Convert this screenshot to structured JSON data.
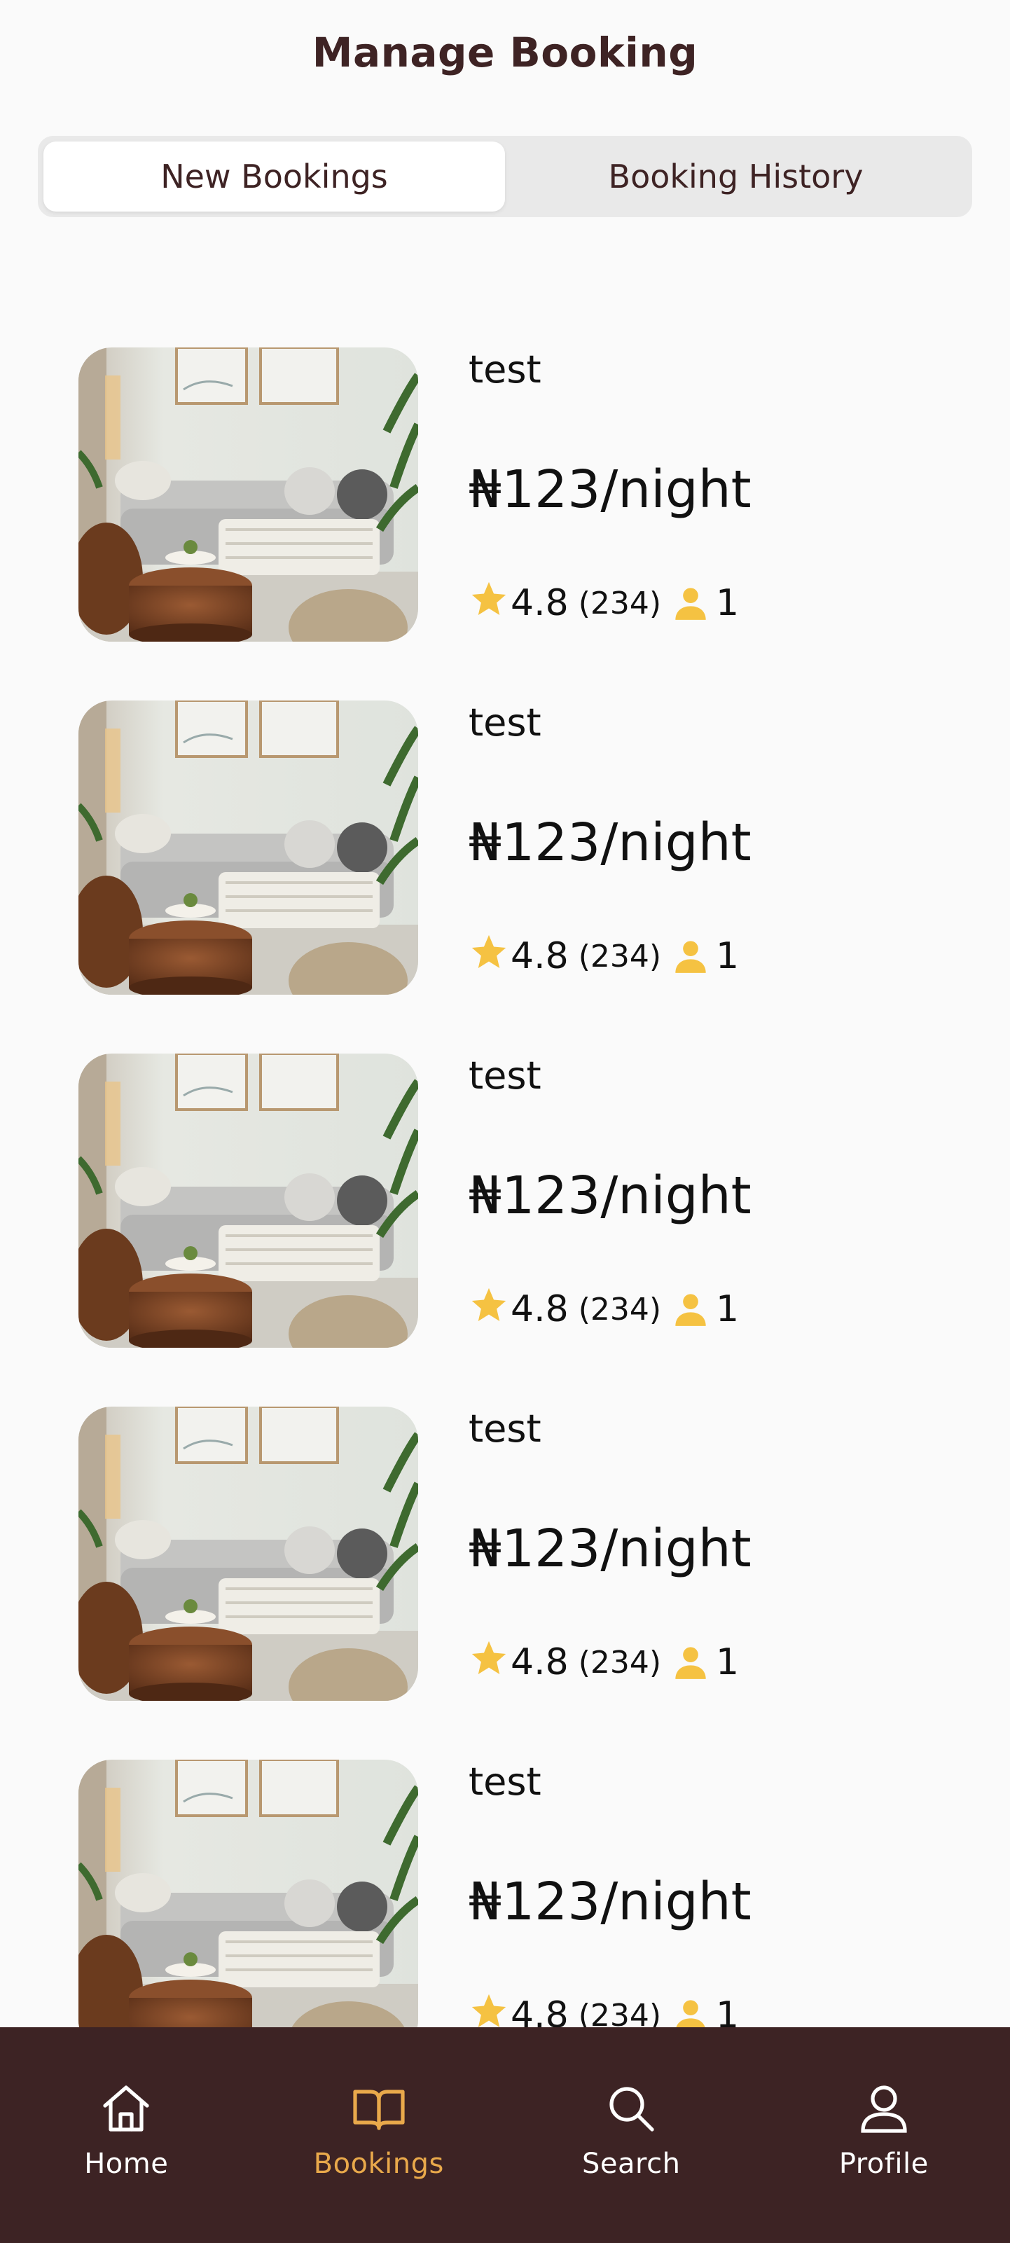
{
  "header": {
    "title": "Manage Booking"
  },
  "tabs": [
    {
      "label": "New Bookings",
      "active": true
    },
    {
      "label": "Booking History",
      "active": false
    }
  ],
  "bookings": [
    {
      "title": "test",
      "price": "₦123/night",
      "rating": "4.8",
      "reviews": "(234)",
      "guests": "1"
    },
    {
      "title": "test",
      "price": "₦123/night",
      "rating": "4.8",
      "reviews": "(234)",
      "guests": "1"
    },
    {
      "title": "test",
      "price": "₦123/night",
      "rating": "4.8",
      "reviews": "(234)",
      "guests": "1"
    },
    {
      "title": "test",
      "price": "₦123/night",
      "rating": "4.8",
      "reviews": "(234)",
      "guests": "1"
    },
    {
      "title": "test",
      "price": "₦123/night",
      "rating": "4.8",
      "reviews": "(234)",
      "guests": "1"
    }
  ],
  "nav": {
    "items": [
      {
        "label": "Home",
        "icon": "home-icon"
      },
      {
        "label": "Bookings",
        "icon": "book-icon",
        "active": true
      },
      {
        "label": "Search",
        "icon": "search-icon"
      },
      {
        "label": "Profile",
        "icon": "user-icon"
      }
    ]
  },
  "colors": {
    "brand_dark": "#3d2324",
    "accent": "#e9a94b",
    "star": "#f5c242",
    "background": "#fafafa"
  }
}
